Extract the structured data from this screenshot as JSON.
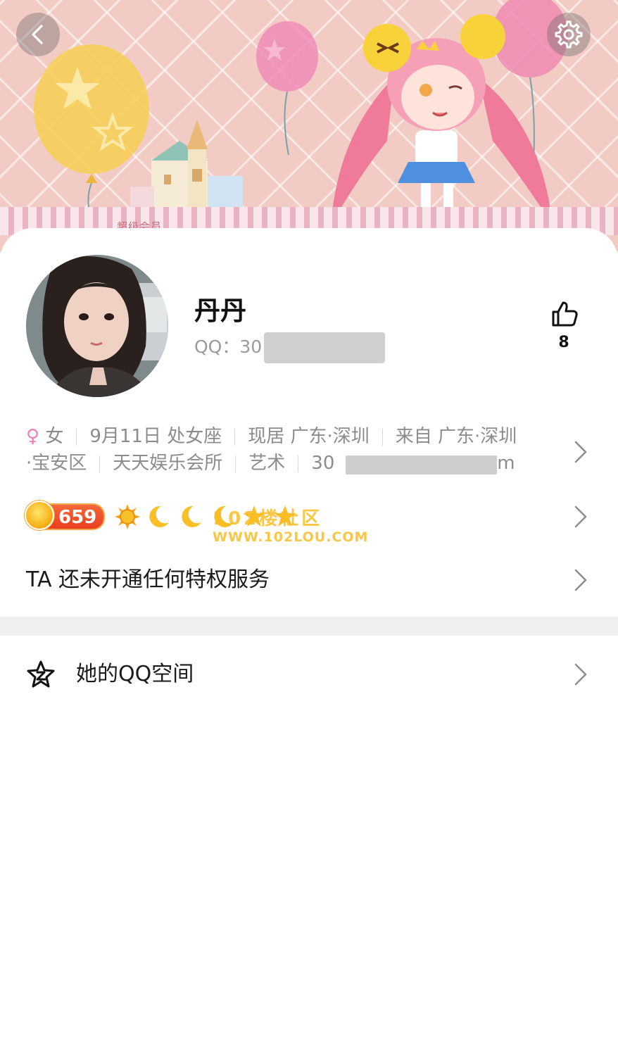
{
  "header": {
    "banner_label": "超级会员",
    "back_icon": "chevron-left-icon",
    "settings_icon": "gear-icon"
  },
  "profile": {
    "nickname": "丹丹",
    "qq_prefix": "QQ：30",
    "likes": "8",
    "like_icon": "thumbs-up-icon"
  },
  "info": {
    "gender_symbol": "♀",
    "gender": "女",
    "birthday": "9月11日 处女座",
    "location": "现居 广东·深圳",
    "hometown": "来自 广东·深圳",
    "district": "·宝安区",
    "company": "天天娱乐会所",
    "occupation": "艺术",
    "email_prefix": "30",
    "email_suffix": "om"
  },
  "level": {
    "value": "659",
    "icons": [
      "sun-icon",
      "moon-icon",
      "moon-icon",
      "moon-icon",
      "star-icon",
      "star-icon"
    ]
  },
  "watermark": {
    "line1": "102楼社区",
    "line2": "WWW.102LOU.COM"
  },
  "privilege": {
    "text": "TA 还未开通任何特权服务"
  },
  "qzone": {
    "label": "她的QQ空间",
    "icon": "qzone-star-icon"
  },
  "colors": {
    "female": "#f27db6",
    "level_badge": "#e8481f",
    "divider": "#f0f0f2",
    "secondary_text": "#8c8c8c"
  }
}
